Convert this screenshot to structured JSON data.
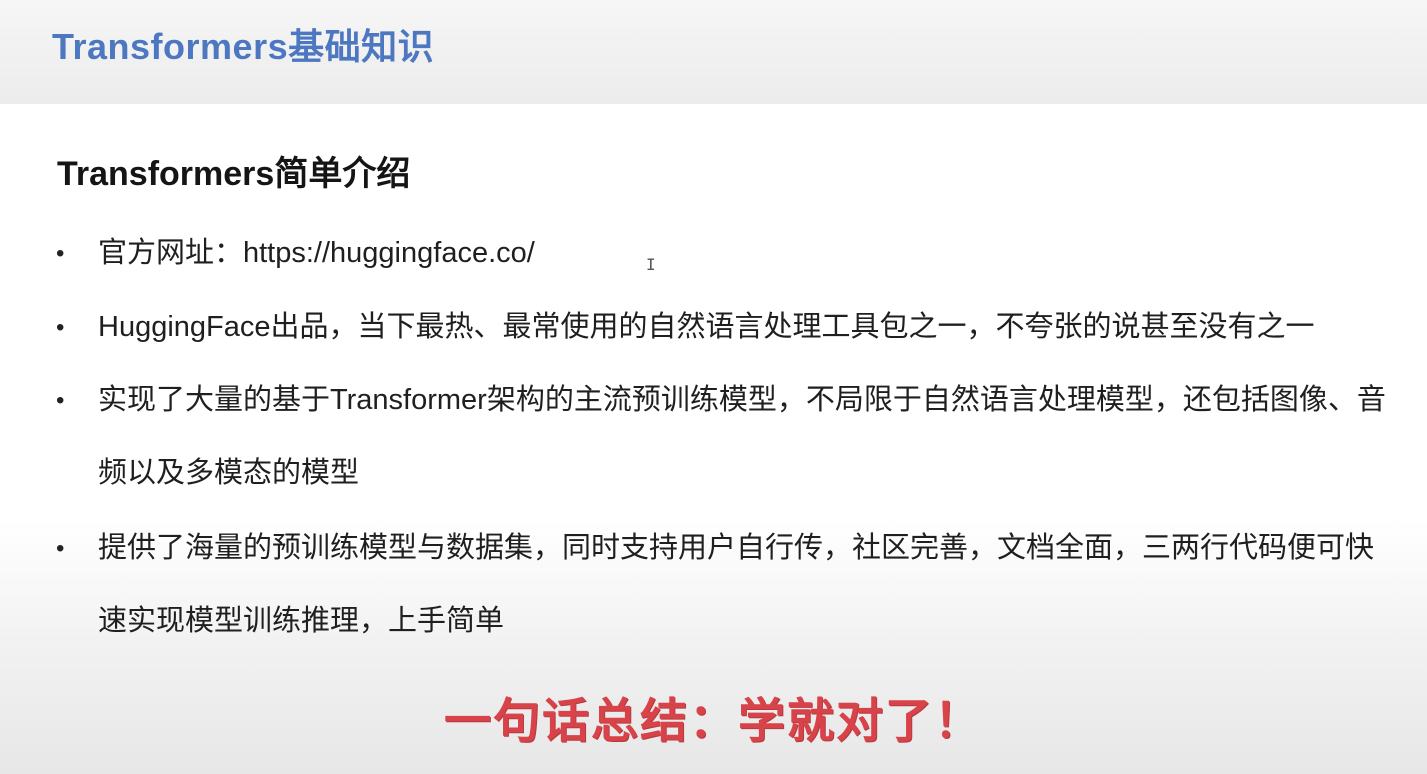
{
  "slide": {
    "title": "Transformers基础知识",
    "section_heading": "Transformers简单介绍",
    "bullets": [
      {
        "text": "官方网址：https://huggingface.co/"
      },
      {
        "text": "HuggingFace出品，当下最热、最常使用的自然语言处理工具包之一，不夸张的说甚至没有之一"
      },
      {
        "text": "实现了大量的基于Transformer架构的主流预训练模型，不局限于自然语言处理模型，还包括图像、音频以及多模态的模型"
      },
      {
        "text": "提供了海量的预训练模型与数据集，同时支持用户自行传，社区完善，文档全面，三两行代码便可快速实现模型训练推理，上手简单"
      }
    ],
    "bullet_symbol": "•",
    "caption": "一句话总结：学就对了！"
  },
  "colors": {
    "title": "#4e77c1",
    "heading": "#151515",
    "body_text": "#1f1f1f",
    "caption": "#d8434a"
  },
  "icons": {
    "cursor": "text-cursor-icon"
  }
}
